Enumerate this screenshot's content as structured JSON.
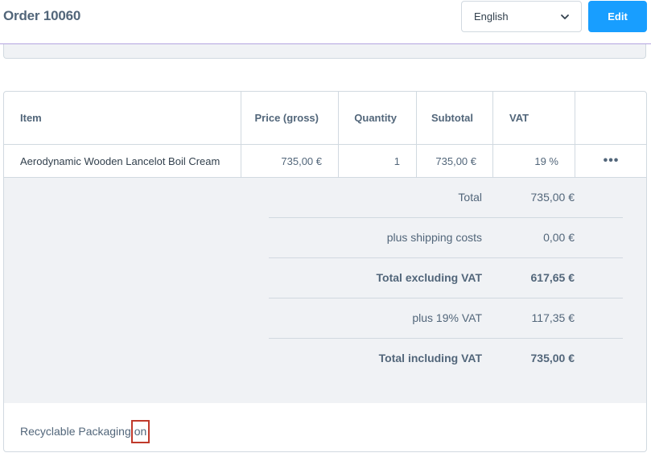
{
  "header": {
    "title": "Order 10060",
    "language": "English",
    "edit_label": "Edit"
  },
  "table": {
    "columns": [
      "Item",
      "Price (gross)",
      "Quantity",
      "Subtotal",
      "VAT",
      ""
    ],
    "rows": [
      {
        "item": "Aerodynamic Wooden Lancelot Boil Cream",
        "price": "735,00 €",
        "quantity": "1",
        "subtotal": "735,00 €",
        "vat": "19 %",
        "more": "•••"
      }
    ]
  },
  "summary": [
    {
      "label": "Total",
      "value": "735,00 €"
    },
    {
      "label": "plus shipping costs",
      "value": "0,00 €"
    },
    {
      "label": "Total excluding VAT",
      "value": "617,65 €"
    },
    {
      "label": "plus 19% VAT",
      "value": "117,35 €"
    },
    {
      "label": "Total including VAT",
      "value": "735,00 €"
    }
  ],
  "custom_field": {
    "label": "Recyclable Packaging",
    "value": "on"
  },
  "colors": {
    "primary": "#189eff",
    "header_border": "#b4a4e0",
    "highlight": "#c0392b"
  }
}
